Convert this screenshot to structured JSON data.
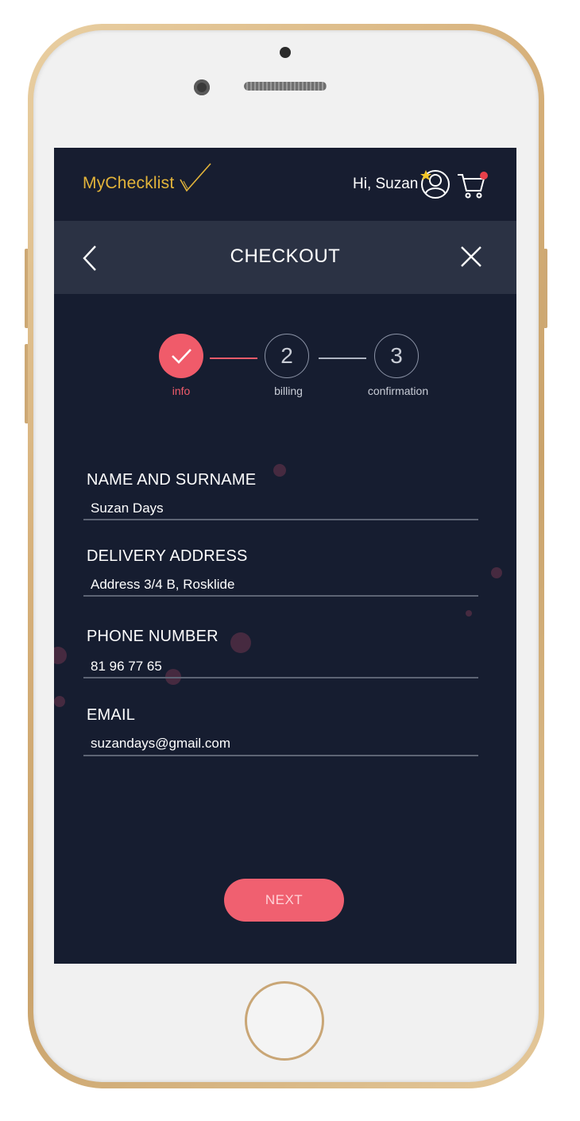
{
  "app": {
    "brand_name": "MyChecklist",
    "greeting": "Hi, Suzan",
    "accent_color": "#f05b6a",
    "logo_color": "#e3b43a",
    "background_color": "#161d30"
  },
  "header": {
    "title": "CHECKOUT",
    "back_icon": "chevron-left-icon",
    "close_icon": "close-icon"
  },
  "steps": [
    {
      "number": "1",
      "label": "info",
      "status": "completed"
    },
    {
      "number": "2",
      "label": "billing",
      "status": "pending"
    },
    {
      "number": "3",
      "label": "confirmation",
      "status": "pending"
    }
  ],
  "form": {
    "fields": [
      {
        "label": "NAME AND SURNAME",
        "value": "Suzan Days"
      },
      {
        "label": "DELIVERY ADDRESS",
        "value": "Address 3/4 B, Rosklide"
      },
      {
        "label": "PHONE NUMBER",
        "value": "81 96 77 65"
      },
      {
        "label": "EMAIL",
        "value": "suzandays@gmail.com"
      }
    ]
  },
  "actions": {
    "next_label": "NEXT"
  }
}
